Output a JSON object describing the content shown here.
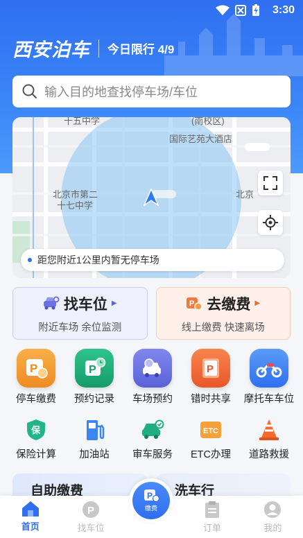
{
  "status_bar": {
    "time": "3:30"
  },
  "header": {
    "city_name": "西安泊车",
    "limit_text": "今日限行 4/9"
  },
  "search": {
    "placeholder": "输入目的地查找停车场/车位"
  },
  "map": {
    "labels": [
      "十五中学",
      "(南校区)",
      "国际艺苑大酒店",
      "北京市第二",
      "十七中学",
      "北京"
    ],
    "notice": "距您附近1公里内暂无停车场"
  },
  "cards": [
    {
      "title": "找车位",
      "subtitle": "附近车场 余位监测"
    },
    {
      "title": "去缴费",
      "subtitle": "线上缴费 快速离场"
    }
  ],
  "services_row1": [
    {
      "label": "停车缴费",
      "icon": "parking-pay-icon",
      "color": "#f39a2b"
    },
    {
      "label": "预约记录",
      "icon": "reservation-record-icon",
      "color": "#22b07d"
    },
    {
      "label": "车场预约",
      "icon": "car-reserve-icon",
      "color": "#6b72e3"
    },
    {
      "label": "错时共享",
      "icon": "shared-parking-icon",
      "color": "#f06a3c"
    },
    {
      "label": "摩托车车位",
      "icon": "motorcycle-icon",
      "color": "#3d86f2"
    }
  ],
  "services_row2": [
    {
      "label": "保险计算",
      "icon": "insurance-icon"
    },
    {
      "label": "加油站",
      "icon": "gas-station-icon"
    },
    {
      "label": "审车服务",
      "icon": "car-inspection-icon"
    },
    {
      "label": "ETC办理",
      "icon": "etc-icon"
    },
    {
      "label": "道路救援",
      "icon": "road-rescue-icon"
    }
  ],
  "promos": {
    "left": "自助缴费",
    "right": "洗车行"
  },
  "tabbar": {
    "home": "首页",
    "find": "找车位",
    "center": "缴费",
    "orders": "订单",
    "mine": "我的"
  }
}
